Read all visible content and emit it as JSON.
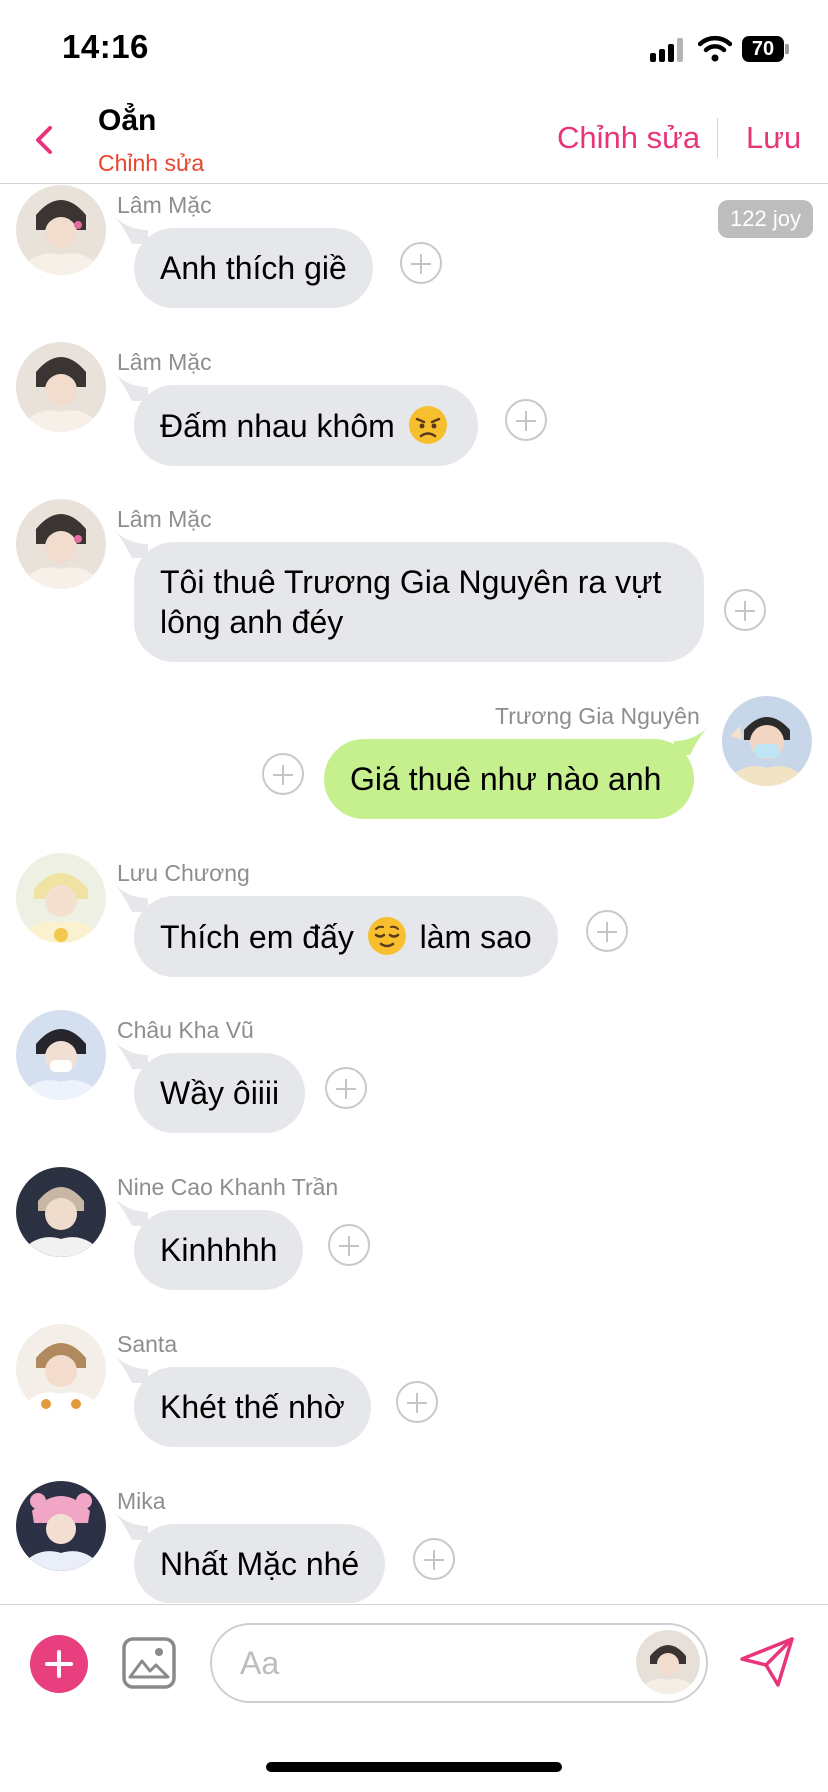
{
  "status_bar": {
    "time": "14:16",
    "battery": "70"
  },
  "header": {
    "title": "Oẳn",
    "subtitle": "Chỉnh sửa",
    "edit_label": "Chỉnh sửa",
    "save_label": "Lưu"
  },
  "chat": {
    "joy_badge": "122 joy",
    "messages": [
      {
        "sender": "Lâm Mặc",
        "text": "Anh thích giề",
        "side": "in",
        "avatar": "lam-mac-avatar"
      },
      {
        "sender": "Lâm Mặc",
        "text": "Đấm nhau khôm",
        "emoji": "angry-face-emoji",
        "side": "in",
        "avatar": "lam-mac-avatar"
      },
      {
        "sender": "Lâm Mặc",
        "text_line1": "Tôi thuê Trương Gia Nguyên ra vựt",
        "text_line2": "lông anh đéy",
        "side": "in",
        "avatar": "lam-mac-avatar"
      },
      {
        "sender": "Trương Gia Nguyên",
        "text": "Giá thuê như nào anh",
        "side": "out",
        "avatar": "truong-gia-nguyen-avatar"
      },
      {
        "sender": "Lưu Chương",
        "text_before": "Thích em đấy",
        "emoji": "relieved-face-emoji",
        "text_after": "làm sao",
        "side": "in",
        "avatar": "luu-chuong-avatar"
      },
      {
        "sender": "Châu Kha Vũ",
        "text": "Wầy ôiiii",
        "side": "in",
        "avatar": "chau-kha-vu-avatar"
      },
      {
        "sender": "Nine Cao Khanh Trần",
        "text": "Kinhhhh",
        "side": "in",
        "avatar": "nine-avatar"
      },
      {
        "sender": "Santa",
        "text": "Khét thế nhờ",
        "side": "in",
        "avatar": "santa-avatar"
      },
      {
        "sender": "Mika",
        "text": "Nhất Mặc nhé",
        "side": "in",
        "avatar": "mika-avatar"
      }
    ]
  },
  "composer": {
    "placeholder": "Aa"
  },
  "colors": {
    "accent": "#e8357a",
    "subtitle": "#e8442e",
    "incoming_bubble": "#e6e7ea",
    "outgoing_bubble": "#c6ef8e",
    "add_button": "#e83f7e"
  }
}
